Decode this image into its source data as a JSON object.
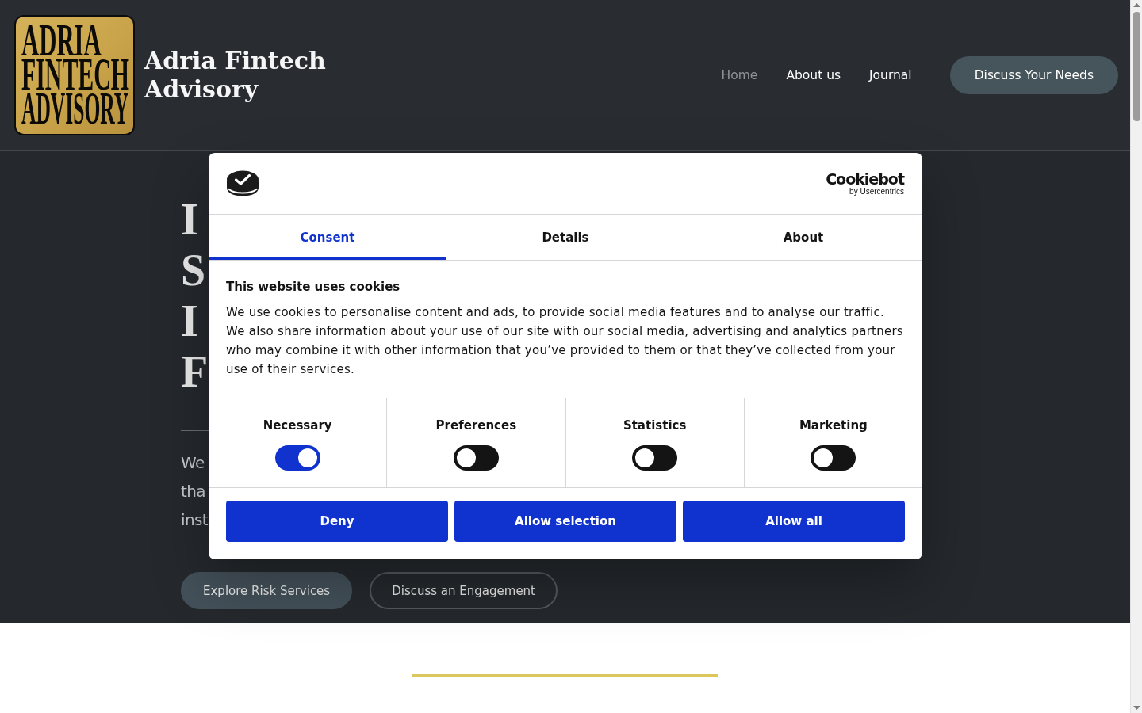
{
  "header": {
    "logo": {
      "lines": [
        "ADRIA",
        "FINTECH",
        "ADVISORY"
      ]
    },
    "site_title": "Adria Fintech Advisory",
    "nav": [
      {
        "label": "Home",
        "selected": true
      },
      {
        "label": "About us",
        "selected": false
      },
      {
        "label": "Journal",
        "selected": false
      }
    ],
    "cta_button": "Discuss Your Needs"
  },
  "hero": {
    "heading_fragments": [
      "I",
      "S",
      "I",
      "F"
    ],
    "paragraph_fragments": [
      "We",
      "tha",
      "inst"
    ],
    "buttons": [
      {
        "label": "Explore Risk Services",
        "kind": "filled"
      },
      {
        "label": "Discuss an Engagement",
        "kind": "outline"
      }
    ]
  },
  "cookie_dialog": {
    "brand": {
      "name": "Cookiebot",
      "byline": "by Usercentrics"
    },
    "tabs": [
      {
        "label": "Consent",
        "selected": true
      },
      {
        "label": "Details",
        "selected": false
      },
      {
        "label": "About",
        "selected": false
      }
    ],
    "title": "This website uses cookies",
    "body": "We use cookies to personalise content and ads, to provide social media features and to analyse our traffic. We also share information about your use of our site with our social media, advertising and analytics partners who may combine it with other information that you’ve provided to them or that they’ve collected from your use of their services.",
    "categories": [
      {
        "label": "Necessary",
        "checked": true
      },
      {
        "label": "Preferences",
        "checked": false
      },
      {
        "label": "Statistics",
        "checked": false
      },
      {
        "label": "Marketing",
        "checked": false
      }
    ],
    "buttons": [
      "Deny",
      "Allow selection",
      "Allow all"
    ]
  }
}
